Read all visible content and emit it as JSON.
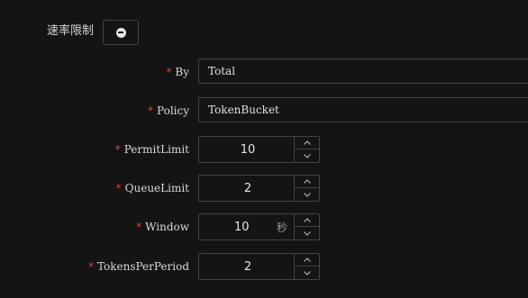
{
  "section": {
    "title": "速率限制"
  },
  "fields": {
    "by": {
      "required_mark": "*",
      "label": "By",
      "value": "Total"
    },
    "policy": {
      "required_mark": "*",
      "label": "Policy",
      "value": "TokenBucket"
    },
    "permit_limit": {
      "required_mark": "*",
      "label": "PermitLimit",
      "value": "10"
    },
    "queue_limit": {
      "required_mark": "*",
      "label": "QueueLimit",
      "value": "2"
    },
    "window": {
      "required_mark": "*",
      "label": "Window",
      "value": "10",
      "unit": "秒"
    },
    "tokens_per_period": {
      "required_mark": "*",
      "label": "TokensPerPeriod",
      "value": "2"
    }
  },
  "icons": {
    "collapse": "minus-circle-icon",
    "increment": "chevron-up-icon",
    "decrement": "chevron-down-icon"
  },
  "colors": {
    "background": "#141414",
    "border": "#434343",
    "required": "#dc4446",
    "text": "#d9d9d9"
  }
}
